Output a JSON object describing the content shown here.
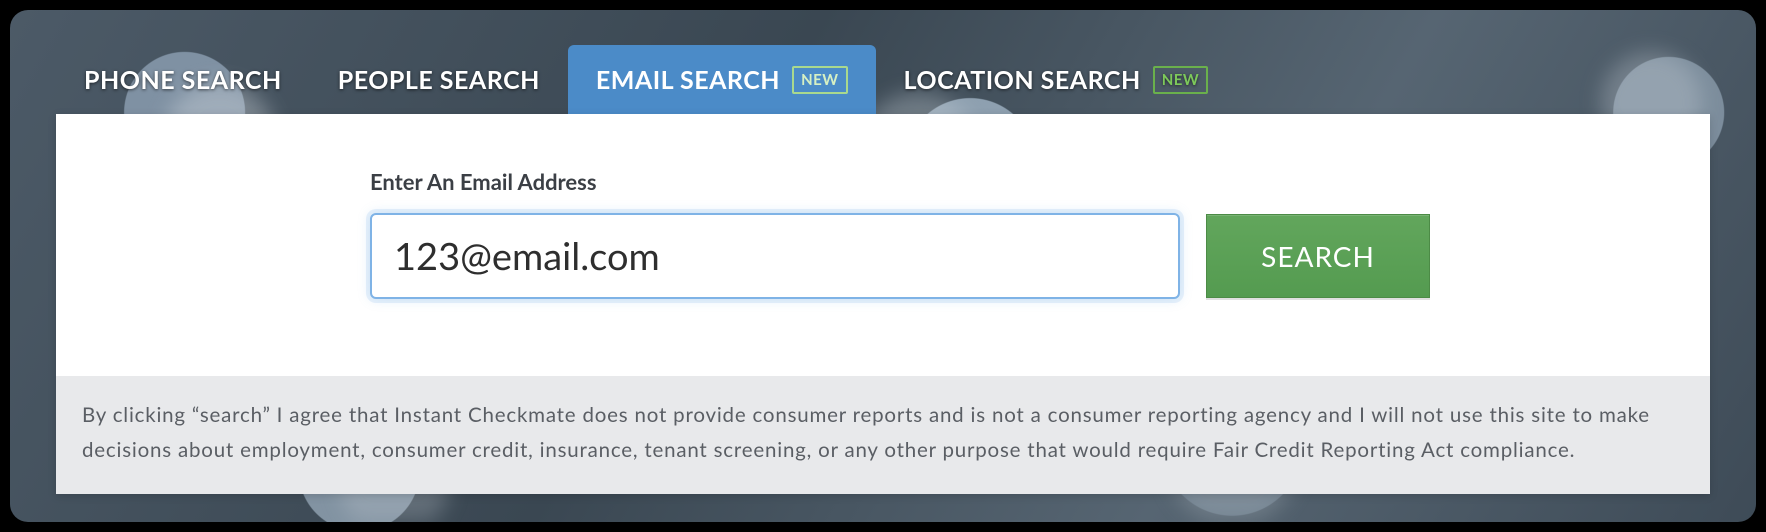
{
  "tabs": [
    {
      "label": "PHONE SEARCH",
      "badge": null,
      "active": false
    },
    {
      "label": "PEOPLE SEARCH",
      "badge": null,
      "active": false
    },
    {
      "label": "EMAIL SEARCH",
      "badge": "NEW",
      "active": true
    },
    {
      "label": "LOCATION SEARCH",
      "badge": "NEW",
      "active": false
    }
  ],
  "form": {
    "field_label": "Enter An Email Address",
    "email_value": "123@email.com",
    "email_placeholder": "",
    "search_button": "SEARCH"
  },
  "disclaimer": "By clicking “search” I agree that Instant Checkmate does not provide consumer reports and is not a consumer reporting agency and I will not use this site to make decisions about employment, consumer credit, insurance, tenant screening, or any other purpose that would require Fair Credit Reporting Act compliance."
}
